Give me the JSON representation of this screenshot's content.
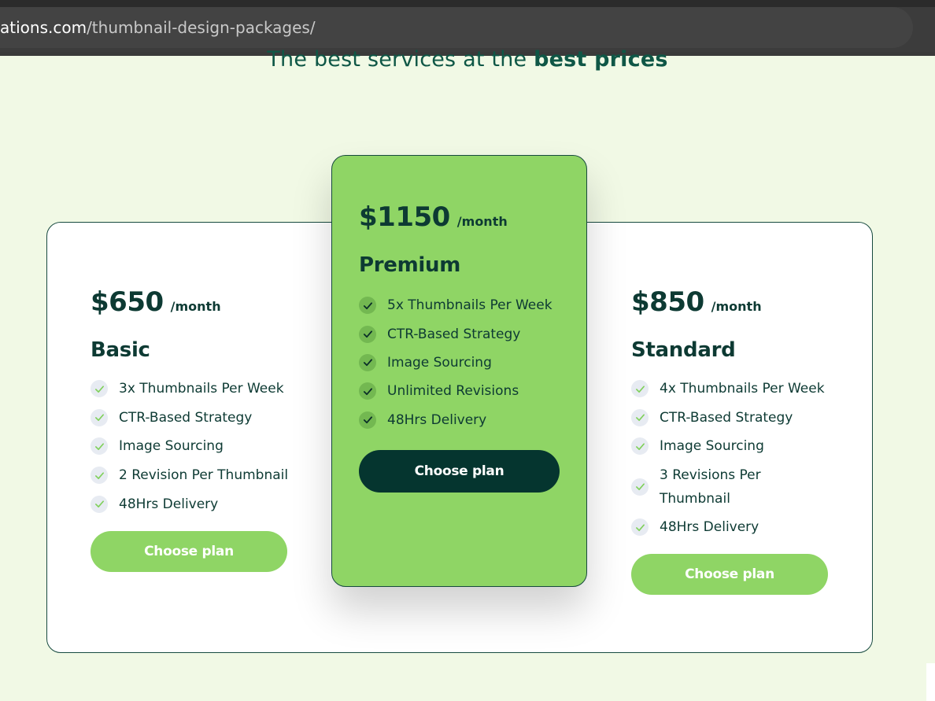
{
  "browser": {
    "url_host": "ations.com",
    "url_path": "/thumbnail-design-packages/"
  },
  "headline": {
    "text": "The best services at the ",
    "bold": "best prices"
  },
  "colors": {
    "page_bg": "#f1f9e5",
    "accent_green": "#8fd565",
    "dark_green": "#05352f",
    "text": "#0d3a33"
  },
  "plans": [
    {
      "price": "$650",
      "period": "/month",
      "name": "Basic",
      "features": [
        "3x Thumbnails Per Week",
        "CTR-Based Strategy",
        "Image Sourcing",
        "2 Revision Per Thumbnail",
        "48Hrs Delivery"
      ],
      "button": "Choose plan"
    },
    {
      "price": "$1150",
      "period": "/month",
      "name": "Premium",
      "features": [
        "5x Thumbnails Per Week",
        "CTR-Based Strategy",
        "Image Sourcing",
        "Unlimited Revisions",
        "48Hrs Delivery"
      ],
      "button": "Choose plan"
    },
    {
      "price": "$850",
      "period": "/month",
      "name": "Standard",
      "features": [
        "4x Thumbnails Per Week",
        "CTR-Based Strategy",
        "Image Sourcing",
        "3 Revisions Per Thumbnail",
        "48Hrs Delivery"
      ],
      "button": "Choose plan"
    }
  ],
  "icons": {
    "feature_check": "check-icon"
  }
}
